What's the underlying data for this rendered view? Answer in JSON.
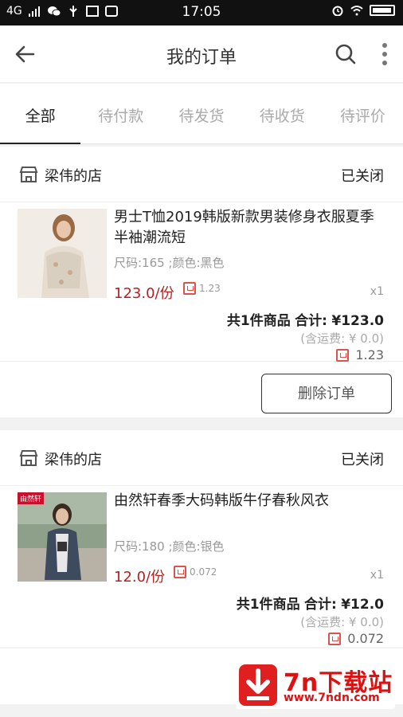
{
  "status_bar": {
    "network": "4G",
    "time": "17:05"
  },
  "app_bar": {
    "title": "我的订单",
    "back_icon": "arrow-left-icon",
    "search_icon": "search-icon",
    "more_icon": "more-vertical-icon"
  },
  "tabs": [
    {
      "label": "全部",
      "active": true
    },
    {
      "label": "待付款",
      "active": false
    },
    {
      "label": "待发货",
      "active": false
    },
    {
      "label": "待收货",
      "active": false
    },
    {
      "label": "待评价",
      "active": false
    }
  ],
  "orders": [
    {
      "shop_name": "梁伟的店",
      "status": "已关闭",
      "item": {
        "name": "男士T恤2019韩版新款男装修身衣服夏季半袖潮流短",
        "spec": "尺码:165 ;颜色:黑色",
        "price": "123.0/份",
        "points": "1.23",
        "qty": "x1"
      },
      "summary_count": "共1件商品",
      "summary_total_label": "合计:",
      "summary_total": "¥123.0",
      "shipping": "(含运费: ¥ 0.0)",
      "summary_points": "1.23",
      "action": "删除订单"
    },
    {
      "shop_name": "梁伟的店",
      "status": "已关闭",
      "item": {
        "name": "由然轩春季大码韩版牛仔春秋风衣",
        "spec": "尺码:180 ;颜色:银色",
        "price": "12.0/份",
        "points": "0.072",
        "qty": "x1",
        "badge": "由然轩"
      },
      "summary_count": "共1件商品",
      "summary_total_label": "合计:",
      "summary_total": "¥12.0",
      "shipping": "(含运费: ¥ 0.0)",
      "summary_points": "0.072"
    }
  ],
  "watermark": {
    "title": "7n下载站",
    "url": "www.7ndn.com"
  },
  "colors": {
    "price_red": "#b22222",
    "point_icon": "#d9534f",
    "watermark_red": "#e02020"
  }
}
